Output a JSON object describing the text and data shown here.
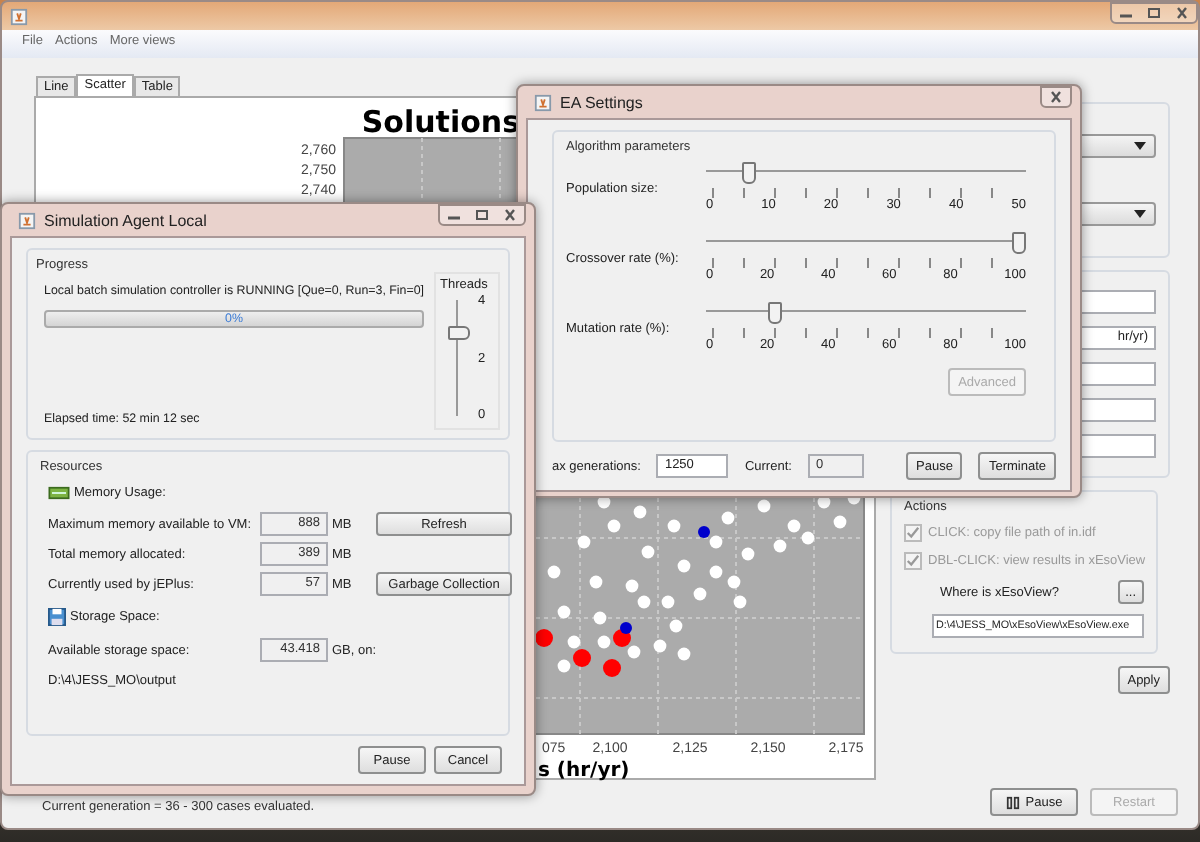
{
  "main_window": {
    "menu": [
      "File",
      "Actions",
      "More views"
    ],
    "tabs": [
      {
        "label": "Line",
        "selected": false
      },
      {
        "label": "Scatter",
        "selected": true
      },
      {
        "label": "Table",
        "selected": false
      }
    ],
    "chart": {
      "title": "Solutions",
      "y_ticks": [
        "2,760",
        "2,750",
        "2,740"
      ],
      "x_ticks": [
        "075",
        "2,100",
        "2,125",
        "2,150",
        "2,175"
      ],
      "x_label": "s (hr/yr)"
    },
    "objective_field": "hr/yr)",
    "actions": {
      "title": "Actions",
      "options": [
        {
          "label": "CLICK: copy file path of in.idf",
          "checked": true,
          "disabled": true
        },
        {
          "label": "DBL-CLICK: view results in xEsoView",
          "checked": true,
          "disabled": true
        }
      ],
      "viewer_label": "Where is xEsoView?",
      "browse": "...",
      "viewer_path": "D:\\4\\JESS_MO\\xEsoView\\xEsoView.exe"
    },
    "apply": "Apply",
    "buttons": [
      {
        "label": "Pause",
        "disabled": false
      },
      {
        "label": "Restart",
        "disabled": true
      }
    ],
    "status": "Current generation = 36 - 300 cases evaluated."
  },
  "ea_settings": {
    "title": "EA Settings",
    "group": "Algorithm parameters",
    "sliders": [
      {
        "label": "Population size:",
        "level": 0.12,
        "ticks": [
          "0",
          "10",
          "20",
          "30",
          "40",
          "50"
        ]
      },
      {
        "label": "Crossover rate (%):",
        "level": 1.0,
        "ticks": [
          "0",
          "20",
          "40",
          "60",
          "80",
          "100"
        ]
      },
      {
        "label": "Mutation rate (%):",
        "level": 0.2,
        "ticks": [
          "0",
          "20",
          "40",
          "60",
          "80",
          "100"
        ]
      }
    ],
    "advanced": {
      "label": "Advanced",
      "disabled": true
    },
    "max_generations_label": "ax generations:",
    "max_generations": "1250",
    "current_label": "Current:",
    "current": "0",
    "buttons": [
      "Pause",
      "Terminate"
    ]
  },
  "simulation_agent": {
    "title": "Simulation Agent Local",
    "progress_group": "Progress",
    "status": "Local batch simulation controller is RUNNING [Que=0, Run=3, Fin=0]",
    "progress": {
      "level": 0.0,
      "text": "0%"
    },
    "threads": {
      "label": "Threads",
      "level": 0.75,
      "ticks": [
        "4",
        "2",
        "0"
      ]
    },
    "elapsed": "Elapsed time: 52 min 12 sec",
    "resources_group": "Resources",
    "memory_heading": "Memory Usage:",
    "rows": [
      {
        "label": "Maximum memory available to VM:",
        "value": "888",
        "unit": "MB",
        "button": "Refresh"
      },
      {
        "label": "Total memory allocated:",
        "value": "389",
        "unit": "MB"
      },
      {
        "label": "Currently used by jEPlus:",
        "value": "57",
        "unit": "MB",
        "button": "Garbage Collection"
      }
    ],
    "storage_heading": "Storage Space:",
    "storage_label": "Available storage space:",
    "storage_value": "43.418",
    "storage_unit": "GB, on:",
    "storage_path": "D:\\4\\JESS_MO\\output",
    "buttons": [
      "Pause",
      "Cancel"
    ]
  }
}
